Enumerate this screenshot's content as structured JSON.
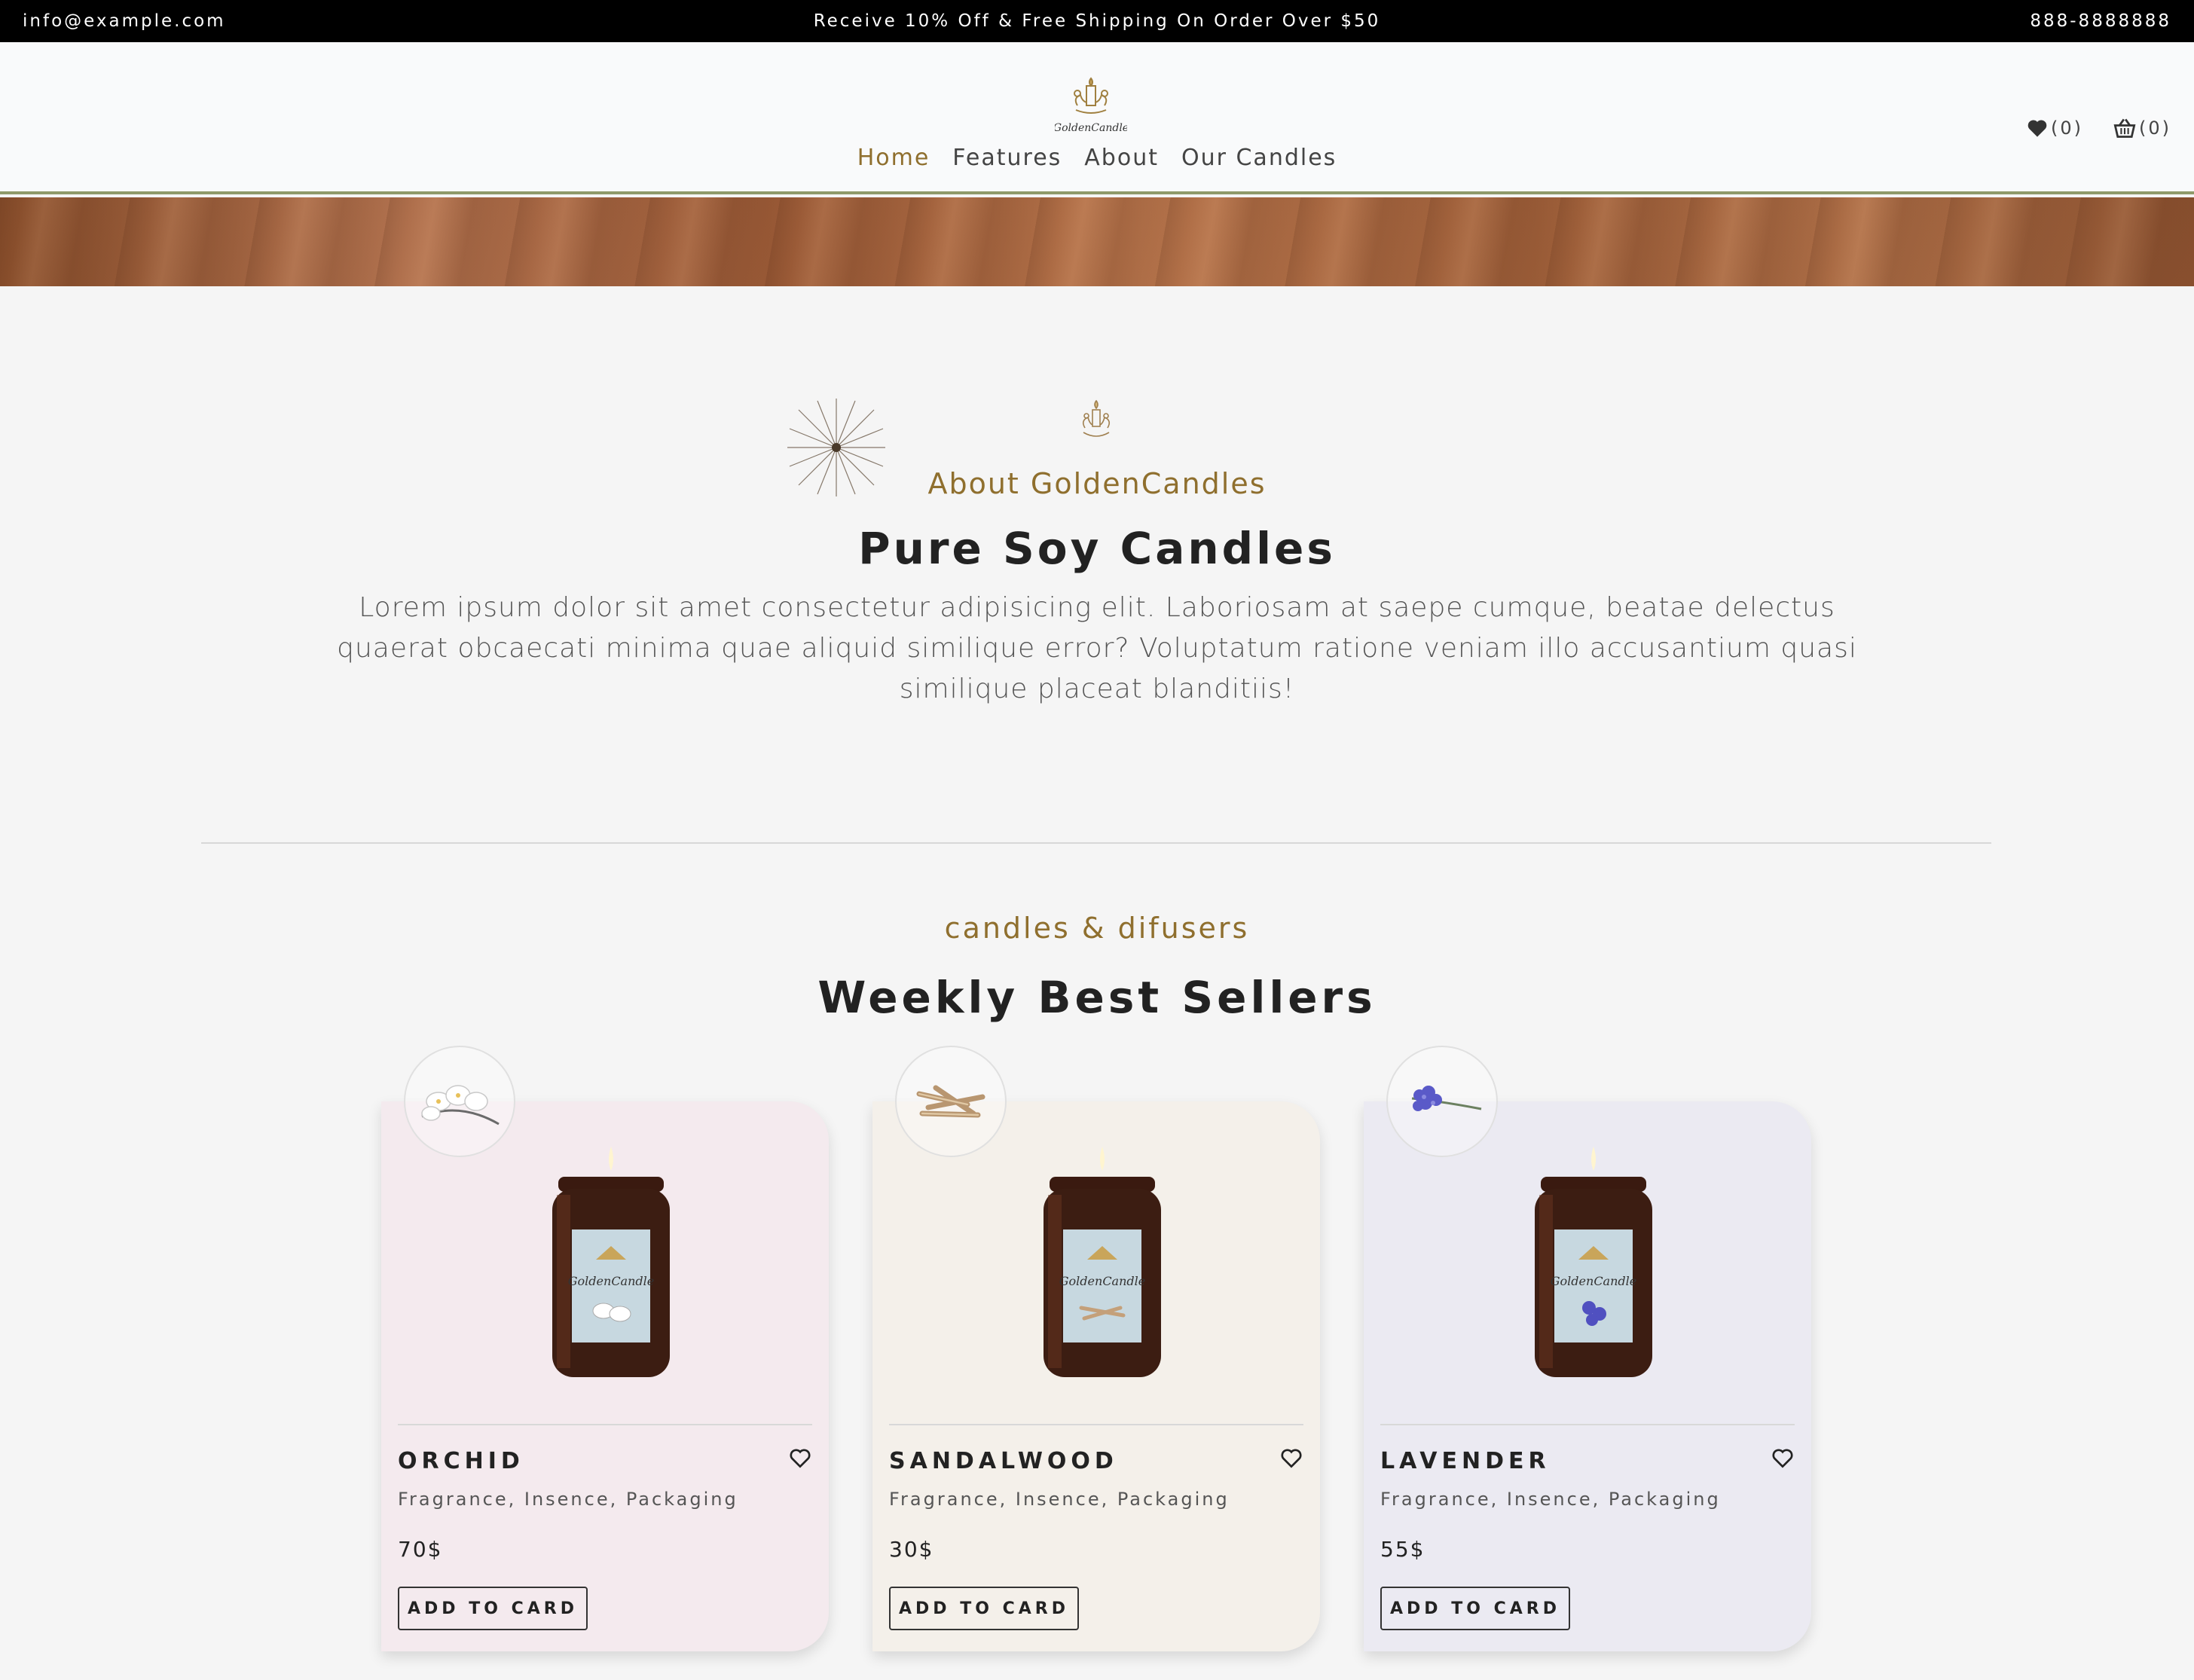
{
  "topbar": {
    "email": "info@example.com",
    "promo": "Receive 10% Off & Free Shipping On Order Over $50",
    "phone": "888-8888888"
  },
  "header": {
    "logo_text": "GoldenCandle",
    "nav": [
      {
        "label": "Home",
        "active": true
      },
      {
        "label": "Features",
        "active": false
      },
      {
        "label": "About",
        "active": false
      },
      {
        "label": "Our Candles",
        "active": false
      }
    ],
    "wishlist_count": "(0)",
    "cart_count": "(0)",
    "icons": {
      "wishlist": "heart-icon",
      "cart": "basket-icon"
    }
  },
  "about": {
    "kicker": "About GoldenCandles",
    "title": "Pure Soy Candles",
    "text": "Lorem ipsum dolor sit amet consectetur adipisicing elit. Laboriosam at saepe cumque, beatae delectus quaerat obcaecati minima quae aliquid similique error? Voluptatum ratione veniam illo accusantium quasi similique placeat blanditiis!"
  },
  "sellers": {
    "kicker": "candles & difusers",
    "title": "Weekly Best Sellers",
    "products": [
      {
        "name": "ORCHID",
        "desc": "Fragrance, Insence, Packaging",
        "price": "70$",
        "button": "ADD TO CARD",
        "bg": "#f4eaee",
        "flower": "orchid",
        "label_text": "GoldenCandle"
      },
      {
        "name": "SANDALWOOD",
        "desc": "Fragrance, Insence, Packaging",
        "price": "30$",
        "button": "ADD TO CARD",
        "bg": "#f4f0ea",
        "flower": "sandalwood",
        "label_text": "GoldenCandle"
      },
      {
        "name": "LAVENDER",
        "desc": "Fragrance, Insence, Packaging",
        "price": "55$",
        "button": "ADD TO CARD",
        "bg": "#ebeaf2",
        "flower": "lavender",
        "label_text": "GoldenCandle"
      }
    ]
  },
  "colors": {
    "accent": "#8f6f2e",
    "topbar": "#000000",
    "header_border": "#8f9a6a"
  }
}
